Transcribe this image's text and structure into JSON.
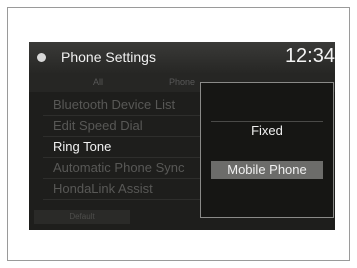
{
  "header": {
    "title": "Phone Settings",
    "clock": "12:34"
  },
  "tabs": [
    {
      "label": "All"
    },
    {
      "label": "Phone"
    }
  ],
  "menu": {
    "items": [
      {
        "label": "Bluetooth Device List"
      },
      {
        "label": "Edit Speed Dial"
      },
      {
        "label": "Ring Tone"
      },
      {
        "label": "Automatic Phone Sync"
      },
      {
        "label": "HondaLink Assist"
      }
    ],
    "selected": "Ring Tone"
  },
  "bottom": {
    "button_label": "Default"
  },
  "popup": {
    "options": [
      {
        "label": "Fixed"
      },
      {
        "label": "Mobile Phone"
      }
    ],
    "selected": "Mobile Phone"
  },
  "colors": {
    "screen_bg": "#1e1e1c",
    "highlight": "#6c6c6a",
    "text": "#f0f0f0",
    "dim_text": "#585856"
  },
  "icons": {
    "header": "settings-dot-icon"
  }
}
